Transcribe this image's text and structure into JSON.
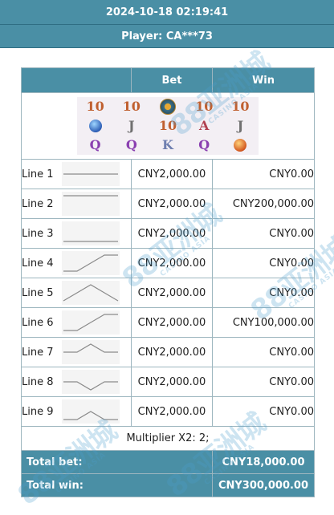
{
  "header": {
    "datetime": "2024-10-18 02:19:41",
    "player": "Player: CA***73"
  },
  "columns": {
    "bet": "Bet",
    "win": "Win"
  },
  "reels": [
    [
      "10",
      "10",
      "wild-gem",
      "10",
      "10"
    ],
    [
      "blue-gem",
      "J",
      "10",
      "A",
      "J"
    ],
    [
      "Q",
      "Q",
      "K",
      "Q",
      "orange-gem"
    ]
  ],
  "lines": [
    {
      "label": "Line 1",
      "bet": "CNY2,000.00",
      "win": "CNY0.00"
    },
    {
      "label": "Line 2",
      "bet": "CNY2,000.00",
      "win": "CNY200,000.00"
    },
    {
      "label": "Line 3",
      "bet": "CNY2,000.00",
      "win": "CNY0.00"
    },
    {
      "label": "Line 4",
      "bet": "CNY2,000.00",
      "win": "CNY0.00"
    },
    {
      "label": "Line 5",
      "bet": "CNY2,000.00",
      "win": "CNY0.00"
    },
    {
      "label": "Line 6",
      "bet": "CNY2,000.00",
      "win": "CNY100,000.00"
    },
    {
      "label": "Line 7",
      "bet": "CNY2,000.00",
      "win": "CNY0.00"
    },
    {
      "label": "Line 8",
      "bet": "CNY2,000.00",
      "win": "CNY0.00"
    },
    {
      "label": "Line 9",
      "bet": "CNY2,000.00",
      "win": "CNY0.00"
    }
  ],
  "multiplier": "Multiplier X2: 2;",
  "totals": {
    "bet_label": "Total bet:",
    "bet_value": "CNY18,000.00",
    "win_label": "Total win:",
    "win_value": "CNY300,000.00"
  },
  "watermark": {
    "logo": "88亚洲城",
    "sub": "CASINO ASIA"
  },
  "colors": {
    "header": "#4a8fa5",
    "border": "#9db6bf",
    "watermark": "#4a9dce"
  }
}
